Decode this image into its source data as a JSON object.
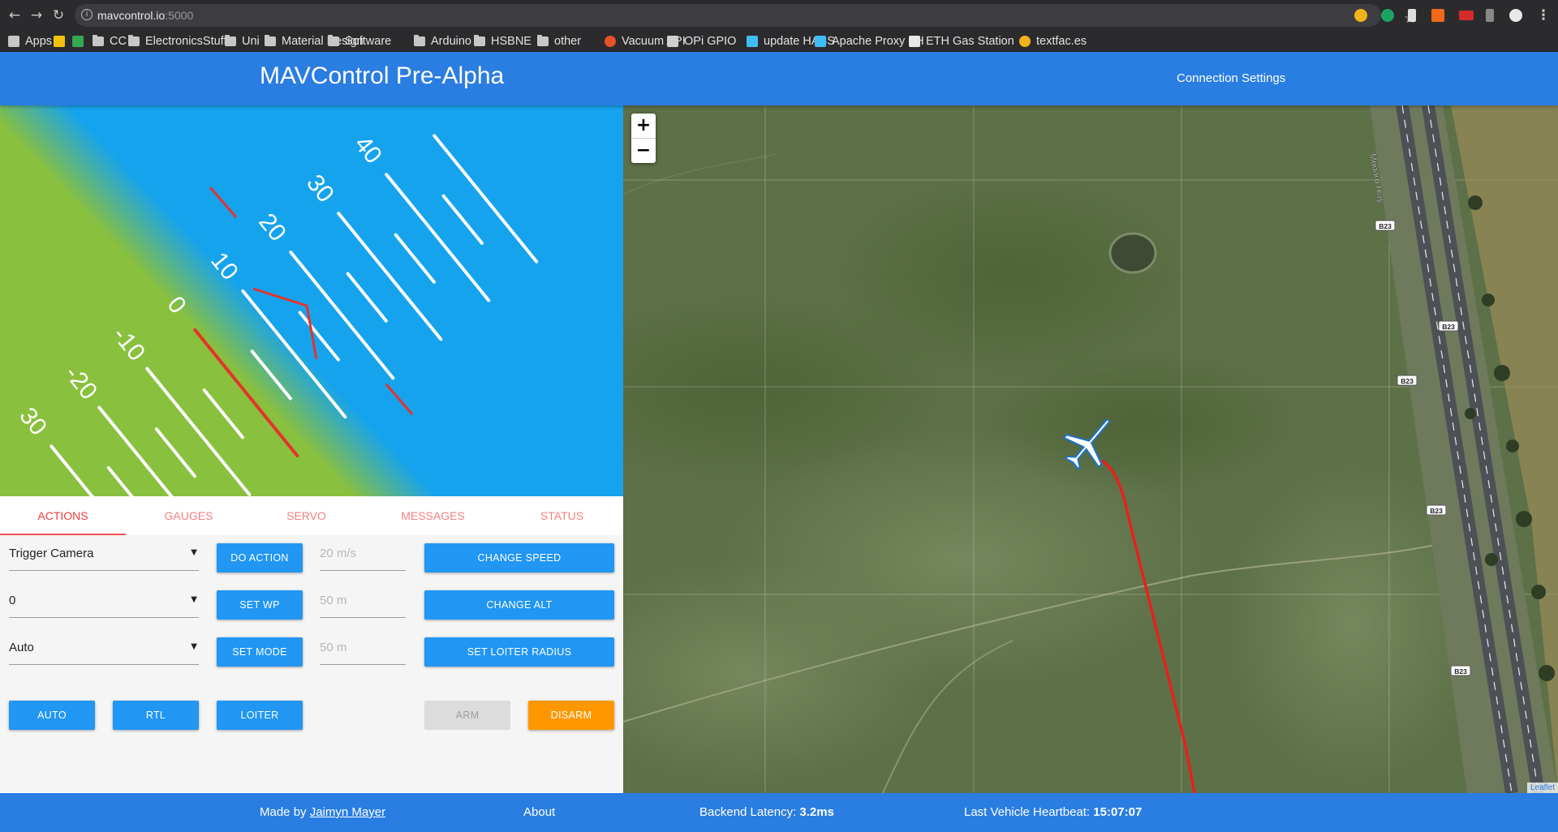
{
  "browser": {
    "url_host": "mavcontrol.io",
    "url_port": ":5000",
    "bookmarks": [
      {
        "label": "Apps",
        "icon": "apps-grid-icon"
      },
      {
        "label": "",
        "icon": "google-drive-icon"
      },
      {
        "label": "",
        "icon": "google-maps-icon"
      },
      {
        "label": "CC",
        "icon": "folder-icon"
      },
      {
        "label": "ElectronicsStuff",
        "icon": "folder-icon"
      },
      {
        "label": "Uni",
        "icon": "folder-icon"
      },
      {
        "label": "Material Design",
        "icon": "folder-icon"
      },
      {
        "label": "Software",
        "icon": "folder-icon"
      },
      {
        "label": "Arduino",
        "icon": "folder-icon"
      },
      {
        "label": "HSBNE",
        "icon": "folder-icon"
      },
      {
        "label": "other",
        "icon": "folder-icon"
      },
      {
        "label": "Vacuum API",
        "icon": "vacuum-icon"
      },
      {
        "label": "OPi GPIO",
        "icon": "doc-icon"
      },
      {
        "label": "update HASS",
        "icon": "hass-icon"
      },
      {
        "label": "Apache Proxy - H",
        "icon": "hass-icon"
      },
      {
        "label": "ETH Gas Station",
        "icon": "gas-icon"
      },
      {
        "label": "textfac.es",
        "icon": "emoji-icon"
      }
    ]
  },
  "header": {
    "title": "MAVControl Pre-Alpha",
    "connection_settings": "Connection Settings"
  },
  "attitude": {
    "sky_color": "#16a3ee",
    "ground_color": "#89c03e",
    "pitch_labels": [
      "40",
      "30",
      "20",
      "10",
      "0",
      "-10",
      "-20",
      "30"
    ]
  },
  "tabs": [
    {
      "label": "ACTIONS",
      "active": true
    },
    {
      "label": "GAUGES",
      "active": false
    },
    {
      "label": "SERVO",
      "active": false
    },
    {
      "label": "MESSAGES",
      "active": false
    },
    {
      "label": "STATUS",
      "active": false
    }
  ],
  "actions": {
    "action_select": "Trigger Camera",
    "wp_select": "0",
    "mode_select": "Auto",
    "do_action": "DO ACTION",
    "set_wp": "SET WP",
    "set_mode": "SET MODE",
    "speed_placeholder": "20 m/s",
    "alt_placeholder": "50 m",
    "loiter_placeholder": "50 m",
    "change_speed": "CHANGE SPEED",
    "change_alt": "CHANGE ALT",
    "set_loiter_radius": "SET LOITER RADIUS",
    "auto": "AUTO",
    "rtl": "RTL",
    "loiter": "LOITER",
    "arm": "ARM",
    "disarm": "DISARM"
  },
  "map": {
    "zoom_in": "+",
    "zoom_out": "−",
    "attribution": "Leaflet",
    "road_name": "Monaro Hwy",
    "road_shields": [
      "B23",
      "B23",
      "B23",
      "B23",
      "B23"
    ],
    "track_color": "#e8201c",
    "aircraft_color": "#1e73c8"
  },
  "footer": {
    "made_by_prefix": "Made by ",
    "author": "Jaimyn Mayer",
    "about": "About",
    "latency_label": "Backend Latency: ",
    "latency_value": "3.2ms",
    "heartbeat_label": "Last Vehicle Heartbeat: ",
    "heartbeat_value": "15:07:07"
  }
}
